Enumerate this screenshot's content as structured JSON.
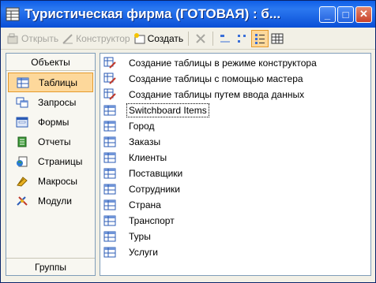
{
  "window": {
    "title": "Туристическая фирма (ГОТОВАЯ) : б...",
    "buttons": {
      "minimize": "_",
      "maximize": "□",
      "close": "✕"
    }
  },
  "toolbar": {
    "open_label": "Открыть",
    "design_label": "Конструктор",
    "create_label": "Создать"
  },
  "objects_bar": {
    "header": "Объекты",
    "items": [
      {
        "label": "Таблицы",
        "icon": "table-icon",
        "selected": true
      },
      {
        "label": "Запросы",
        "icon": "query-icon",
        "selected": false
      },
      {
        "label": "Формы",
        "icon": "form-icon",
        "selected": false
      },
      {
        "label": "Отчеты",
        "icon": "report-icon",
        "selected": false
      },
      {
        "label": "Страницы",
        "icon": "page-icon",
        "selected": false
      },
      {
        "label": "Макросы",
        "icon": "macro-icon",
        "selected": false
      },
      {
        "label": "Модули",
        "icon": "module-icon",
        "selected": false
      }
    ],
    "footer": "Группы"
  },
  "list": {
    "items": [
      {
        "label": "Создание таблицы в режиме конструктора",
        "icon": "wizard-icon"
      },
      {
        "label": "Создание таблицы с помощью мастера",
        "icon": "wizard-icon"
      },
      {
        "label": "Создание таблицы путем ввода данных",
        "icon": "wizard-icon"
      },
      {
        "label": "Switchboard Items",
        "icon": "table-icon"
      },
      {
        "label": "Город",
        "icon": "table-icon"
      },
      {
        "label": "Заказы",
        "icon": "table-icon"
      },
      {
        "label": "Клиенты",
        "icon": "table-icon"
      },
      {
        "label": "Поставщики",
        "icon": "table-icon"
      },
      {
        "label": "Сотрудники",
        "icon": "table-icon"
      },
      {
        "label": "Страна",
        "icon": "table-icon"
      },
      {
        "label": "Транспорт",
        "icon": "table-icon"
      },
      {
        "label": "Туры",
        "icon": "table-icon"
      },
      {
        "label": "Услуги",
        "icon": "table-icon"
      }
    ]
  }
}
